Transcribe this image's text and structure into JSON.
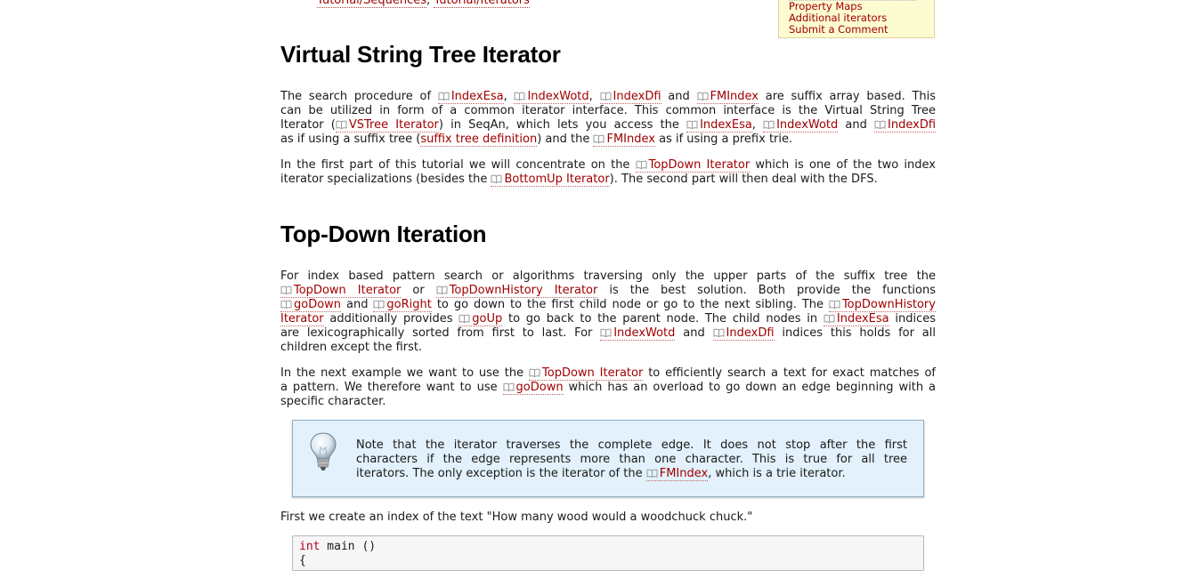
{
  "prereq": {
    "links": [
      "Tutorial/Sequences",
      "Tutorial/Iterators"
    ],
    "sep": ", "
  },
  "toc": {
    "items": [
      "Property Maps",
      "Additional iterators",
      "Submit a Comment"
    ]
  },
  "section1": {
    "title": "Virtual String Tree Iterator",
    "p1": {
      "l1": [
        "The search procedure of ",
        "IndexEsa",
        ", ",
        "IndexWotd",
        ", ",
        "IndexDfi",
        " and ",
        "FMIndex",
        " are suffix array based. This"
      ],
      "l2": "can be utilized in form of a common iterator interface. This common interface is the Virtual String Tree",
      "l3": [
        "Iterator (",
        "VSTree Iterator",
        ") in SeqAn, which lets you access the ",
        "IndexEsa",
        ", ",
        "IndexWotd",
        " and ",
        "IndexDfi"
      ],
      "l4": [
        "as if using a suffix tree (",
        "suffix tree definition",
        ") and the ",
        "FMIndex",
        " as if using a prefix trie."
      ]
    },
    "p2": {
      "l1": [
        "In the first part of this tutorial we will concentrate on the ",
        "TopDown Iterator",
        " which is one of the two index"
      ],
      "l2": [
        "iterator specializations (besides the ",
        "BottomUp Iterator",
        "). The second part will then deal with the DFS."
      ]
    }
  },
  "section2": {
    "title": "Top-Down Iteration",
    "p1": {
      "l1": "For index based pattern search or algorithms traversing only the upper parts of the suffix tree the",
      "l2": [
        "TopDown Iterator",
        " or ",
        "TopDownHistory Iterator",
        " is the best solution. Both provide the functions"
      ],
      "l3": [
        "goDown",
        " and ",
        "goRight",
        " to go down to the first child node or go to the next sibling. The ",
        "TopDownHistory"
      ],
      "l4": [
        "Iterator",
        " additionally provides ",
        "goUp",
        " to go back to the parent node. The child nodes in ",
        "IndexEsa",
        " indices"
      ],
      "l5": [
        "are lexicographically sorted from first to last. For ",
        "IndexWotd",
        " and ",
        "IndexDfi",
        " indices this holds for all"
      ],
      "l6": "children except the first."
    },
    "p2": {
      "l1": [
        "In the next example we want to use the ",
        "TopDown Iterator",
        " to efficiently search a text for exact matches of"
      ],
      "l2": [
        "a pattern. We therefore want to use ",
        "goDown",
        " which has an overload to go down an edge beginning with a"
      ],
      "l3": "specific character."
    },
    "note": {
      "l1": "Note that the iterator traverses the complete edge. It does not stop after the first",
      "l2": "characters if the edge represents more than one character. This is true for all tree",
      "l3": [
        "iterators. The only exception is the iterator of the ",
        "FMIndex",
        ", which is a trie iterator."
      ]
    },
    "p3": "First we create an index of the text \"How many wood would a woodchuck chuck.\"",
    "code": {
      "kw": "int",
      "rest": " main ()",
      "line2": "{"
    }
  }
}
